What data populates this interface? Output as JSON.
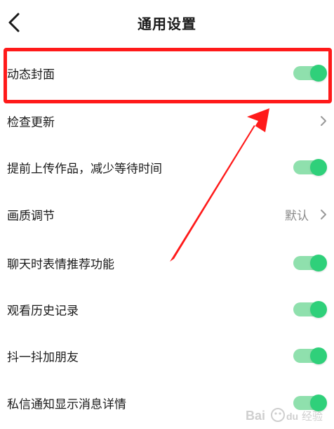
{
  "header": {
    "title": "通用设置"
  },
  "settings": {
    "items": [
      {
        "label": "动态封面",
        "control": "toggle",
        "on": true
      },
      {
        "label": "检查更新",
        "control": "chevron"
      },
      {
        "label": "提前上传作品，减少等待时间",
        "control": "toggle",
        "on": true
      },
      {
        "label": "画质调节",
        "control": "chevron",
        "value": "默认"
      },
      {
        "label": "聊天时表情推荐功能",
        "control": "toggle",
        "on": true
      },
      {
        "label": "观看历史记录",
        "control": "toggle",
        "on": true
      },
      {
        "label": "抖一抖加朋友",
        "control": "toggle",
        "on": true
      },
      {
        "label": "私信通知显示消息详情",
        "control": "toggle",
        "on": true
      }
    ]
  },
  "colors": {
    "toggle_on_track": "#8fe0ad",
    "toggle_on_knob": "#2fd07a",
    "annotation": "#ff1a1a"
  },
  "watermark": {
    "text": "Bai du 经验"
  }
}
